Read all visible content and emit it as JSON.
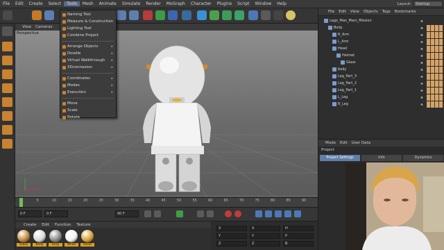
{
  "menubar": {
    "items": [
      "File",
      "Edit",
      "Create",
      "Select",
      "Tools",
      "Mesh",
      "Animate",
      "Simulate",
      "Render",
      "MoGraph",
      "Character",
      "Plugins",
      "Script",
      "Window",
      "Help"
    ],
    "layout_label": "Layout:",
    "layout_value": "Startup"
  },
  "tools_menu": {
    "items": [
      {
        "label": "Naming Tool",
        "submenu": false
      },
      {
        "label": "Measure & Construction",
        "submenu": false
      },
      {
        "label": "Lighting Tool",
        "submenu": false
      },
      {
        "label": "Combine Project",
        "submenu": false
      },
      {
        "label": "Arrange Objects",
        "submenu": true
      },
      {
        "label": "Doodle",
        "submenu": true
      },
      {
        "label": "Virtual Walkthrough",
        "submenu": true
      },
      {
        "label": "3Dconnexion",
        "submenu": true
      },
      {
        "label": "Coordinates",
        "submenu": true
      },
      {
        "label": "Modes",
        "submenu": true
      },
      {
        "label": "Execution",
        "submenu": true
      },
      {
        "label": "Move",
        "submenu": false
      },
      {
        "label": "Scale",
        "submenu": false
      },
      {
        "label": "Rotate",
        "submenu": false
      }
    ]
  },
  "viewport": {
    "menu": [
      "View",
      "Cameras"
    ],
    "label": "Perspective"
  },
  "timeline": {
    "ticks": [
      "0",
      "5",
      "10",
      "15",
      "20",
      "25",
      "30",
      "35",
      "40",
      "45",
      "50",
      "55",
      "60",
      "65",
      "70",
      "75",
      "80",
      "85",
      "90"
    ],
    "current_frame": "0 F",
    "start_field": "0 F",
    "end_field": "90 F"
  },
  "material_manager": {
    "menu": [
      "Create",
      "Edit",
      "Function",
      "Texture"
    ],
    "materials": [
      {
        "name": "Glass",
        "color": "#c08a40"
      },
      {
        "name": "Body",
        "color": "#d9d9d9"
      },
      {
        "name": "Grey",
        "color": "#8a8a8a"
      },
      {
        "name": "White",
        "color": "#f2f2f2"
      },
      {
        "name": "Head",
        "color": "#d8a23a"
      }
    ]
  },
  "coordinates": {
    "rows": [
      [
        "X",
        "X",
        "H"
      ],
      [
        "Y",
        "Y",
        "P"
      ],
      [
        "Z",
        "Z",
        "B"
      ]
    ]
  },
  "object_manager": {
    "menu": [
      "File",
      "Edit",
      "View",
      "Objects",
      "Tags",
      "Bookmarks"
    ],
    "objects": [
      {
        "name": "Lego_Man_Mars_Mission",
        "indent": 0
      },
      {
        "name": "Body",
        "indent": 1
      },
      {
        "name": "R_Arm",
        "indent": 2
      },
      {
        "name": "L_Arm",
        "indent": 2
      },
      {
        "name": "Head",
        "indent": 2
      },
      {
        "name": "Helmet",
        "indent": 3
      },
      {
        "name": "Glass",
        "indent": 4
      },
      {
        "name": "body",
        "indent": 2
      },
      {
        "name": "Leg_Part_3",
        "indent": 2
      },
      {
        "name": "Leg_Part_2",
        "indent": 2
      },
      {
        "name": "Leg_Part_1",
        "indent": 2
      },
      {
        "name": "L_Leg",
        "indent": 2
      },
      {
        "name": "R_Leg",
        "indent": 2
      }
    ]
  },
  "attribute_manager": {
    "menu": [
      "Mode",
      "Edit",
      "User Data"
    ],
    "title": "Project",
    "tabs": [
      "Project Settings",
      "Info",
      "Dynamics"
    ]
  },
  "colors": {
    "accent": "#5f7fa8",
    "orange_icon": "#c9822f",
    "menu_bg": "#3a3a3a",
    "material_label": "#e0a020"
  }
}
